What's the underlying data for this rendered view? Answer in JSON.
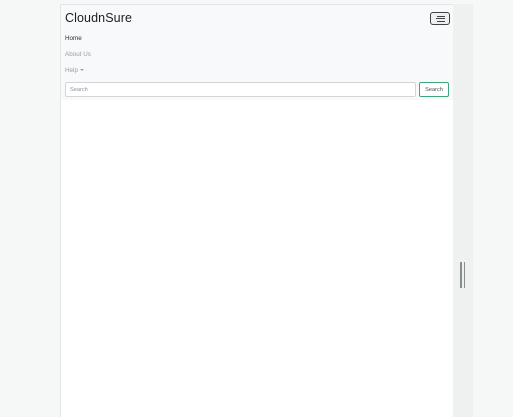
{
  "navbar": {
    "brand": "CloudnSure",
    "toggler_icon": "hamburger-menu-icon",
    "links": [
      {
        "label": "Home",
        "active": true
      },
      {
        "label": "About Us",
        "active": false
      },
      {
        "label": "Help",
        "active": false,
        "dropdown": true
      }
    ],
    "search": {
      "placeholder": "Search",
      "value": "",
      "button_label": "Search"
    }
  },
  "colors": {
    "navbar_bg": "#f8f9fa",
    "search_button_border": "#3fa67a",
    "active_link": "#2a2e31",
    "inactive_link": "#9aa0a4"
  }
}
